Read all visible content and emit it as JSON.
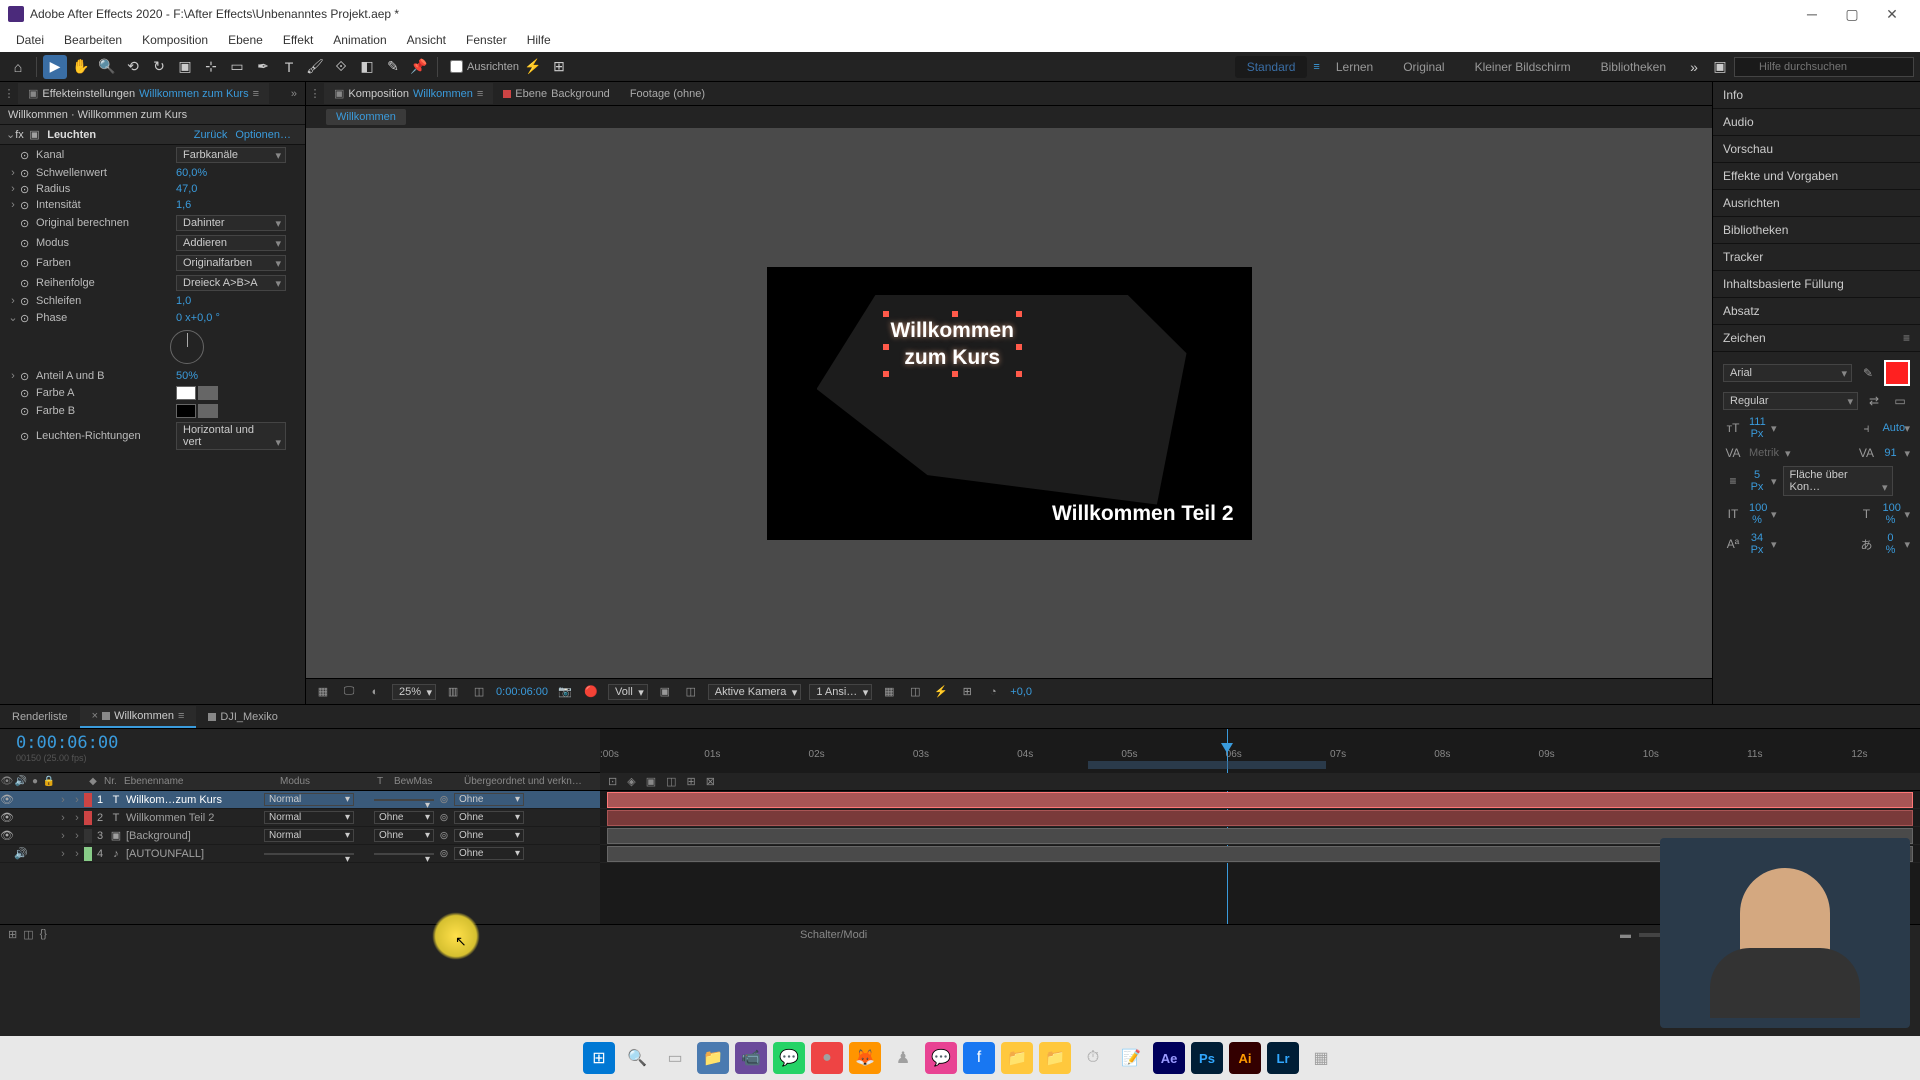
{
  "window": {
    "title": "Adobe After Effects 2020 - F:\\After Effects\\Unbenanntes Projekt.aep *"
  },
  "menu": [
    "Datei",
    "Bearbeiten",
    "Komposition",
    "Ebene",
    "Effekt",
    "Animation",
    "Ansicht",
    "Fenster",
    "Hilfe"
  ],
  "toolbar": {
    "align_label": "Ausrichten",
    "workspaces": [
      "Standard",
      "Lernen",
      "Original",
      "Kleiner Bildschirm",
      "Bibliotheken"
    ],
    "active_workspace": 0,
    "search_placeholder": "Hilfe durchsuchen"
  },
  "effects_panel": {
    "tab_label": "Effekteinstellungen",
    "tab_highlight": "Willkommen zum Kurs",
    "sub": "Willkommen · Willkommen zum Kurs",
    "fx_name": "Leuchten",
    "reset": "Zurück",
    "options": "Optionen…",
    "props": [
      {
        "label": "Kanal",
        "type": "dd",
        "val": "Farbkanäle"
      },
      {
        "label": "Schwellenwert",
        "type": "val",
        "val": "60,0%",
        "exp": "›"
      },
      {
        "label": "Radius",
        "type": "val",
        "val": "47,0",
        "exp": "›"
      },
      {
        "label": "Intensität",
        "type": "val",
        "val": "1,6",
        "exp": "›"
      },
      {
        "label": "Original berechnen",
        "type": "dd",
        "val": "Dahinter"
      },
      {
        "label": "Modus",
        "type": "dd",
        "val": "Addieren"
      },
      {
        "label": "Farben",
        "type": "dd",
        "val": "Originalfarben"
      },
      {
        "label": "Reihenfolge",
        "type": "dd",
        "val": "Dreieck A>B>A"
      },
      {
        "label": "Schleifen",
        "type": "val",
        "val": "1,0",
        "exp": "›"
      },
      {
        "label": "Phase",
        "type": "val",
        "val": "0 x+0,0 °",
        "exp": "⌄"
      },
      {
        "label": "Anteil A und B",
        "type": "val",
        "val": "50%",
        "exp": "›"
      },
      {
        "label": "Farbe A",
        "type": "sw",
        "val": "white"
      },
      {
        "label": "Farbe B",
        "type": "sw",
        "val": "black"
      },
      {
        "label": "Leuchten-Richtungen",
        "type": "dd",
        "val": "Horizontal und vert"
      }
    ]
  },
  "comp_panel": {
    "tab_prefix": "Komposition",
    "tab_name": "Willkommen",
    "tab2_prefix": "Ebene",
    "tab2_name": "Background",
    "tab3": "Footage (ohne)",
    "crumb": "Willkommen",
    "text1_line1": "Willkommen",
    "text1_line2": "zum Kurs",
    "text2": "Willkommen Teil 2",
    "zoom": "25%",
    "timecode": "0:00:06:00",
    "res": "Voll",
    "view": "Aktive Kamera",
    "views": "1 Ansi…",
    "exposure": "+0,0"
  },
  "right_panes": [
    "Info",
    "Audio",
    "Vorschau",
    "Effekte und Vorgaben",
    "Ausrichten",
    "Bibliotheken",
    "Tracker",
    "Inhaltsbasierte Füllung",
    "Absatz"
  ],
  "char": {
    "title": "Zeichen",
    "font": "Arial",
    "style": "Regular",
    "size": "111 Px",
    "leading": "Auto",
    "kerning": "Metrik",
    "tracking": "91",
    "stroke": "5 Px",
    "fill_over": "Fläche über Kon…",
    "vscale": "100 %",
    "hscale": "100 %",
    "baseline": "34 Px",
    "tsume": "0 %"
  },
  "timeline": {
    "tabs": [
      "Renderliste",
      "Willkommen",
      "DJI_Mexiko"
    ],
    "active_tab": 1,
    "timecode": "0:00:06:00",
    "fps_hint": "00150 (25.00 fps)",
    "cols": {
      "nr": "Nr.",
      "name": "Ebenenname",
      "mode": "Modus",
      "t": "T",
      "bew": "BewMas",
      "par": "Übergeordnet und verkn…"
    },
    "layers": [
      {
        "nr": "1",
        "icon": "T",
        "name": "Willkom…zum Kurs",
        "mode": "Normal",
        "bew": "",
        "par": "Ohne",
        "color": "#cc4444",
        "sel": true,
        "eye": true
      },
      {
        "nr": "2",
        "icon": "T",
        "name": "Willkommen Teil 2",
        "mode": "Normal",
        "bew": "Ohne",
        "par": "Ohne",
        "color": "#cc4444",
        "sel": false,
        "eye": true
      },
      {
        "nr": "3",
        "icon": "▣",
        "name": "[Background]",
        "mode": "Normal",
        "bew": "Ohne",
        "par": "Ohne",
        "color": "#333",
        "sel": false,
        "eye": true
      },
      {
        "nr": "4",
        "icon": "♪",
        "name": "[AUTOUNFALL]",
        "mode": "",
        "bew": "",
        "par": "Ohne",
        "color": "#88cc88",
        "sel": false,
        "eye": false,
        "audio": true
      }
    ],
    "ticks": [
      ":00s",
      "01s",
      "02s",
      "03s",
      "04s",
      "05s",
      "06s",
      "07s",
      "08s",
      "09s",
      "10s",
      "11s",
      "12s"
    ],
    "foot": "Schalter/Modi"
  },
  "taskbar_icons": [
    "⊞",
    "🔍",
    "▭",
    "▤",
    "📹",
    "💬",
    "●",
    "🦊",
    "♟",
    "💬",
    "f",
    "📁",
    "📁",
    "⏱",
    "📝",
    "Ae",
    "Ps",
    "Ai",
    "Lr",
    "▦"
  ]
}
